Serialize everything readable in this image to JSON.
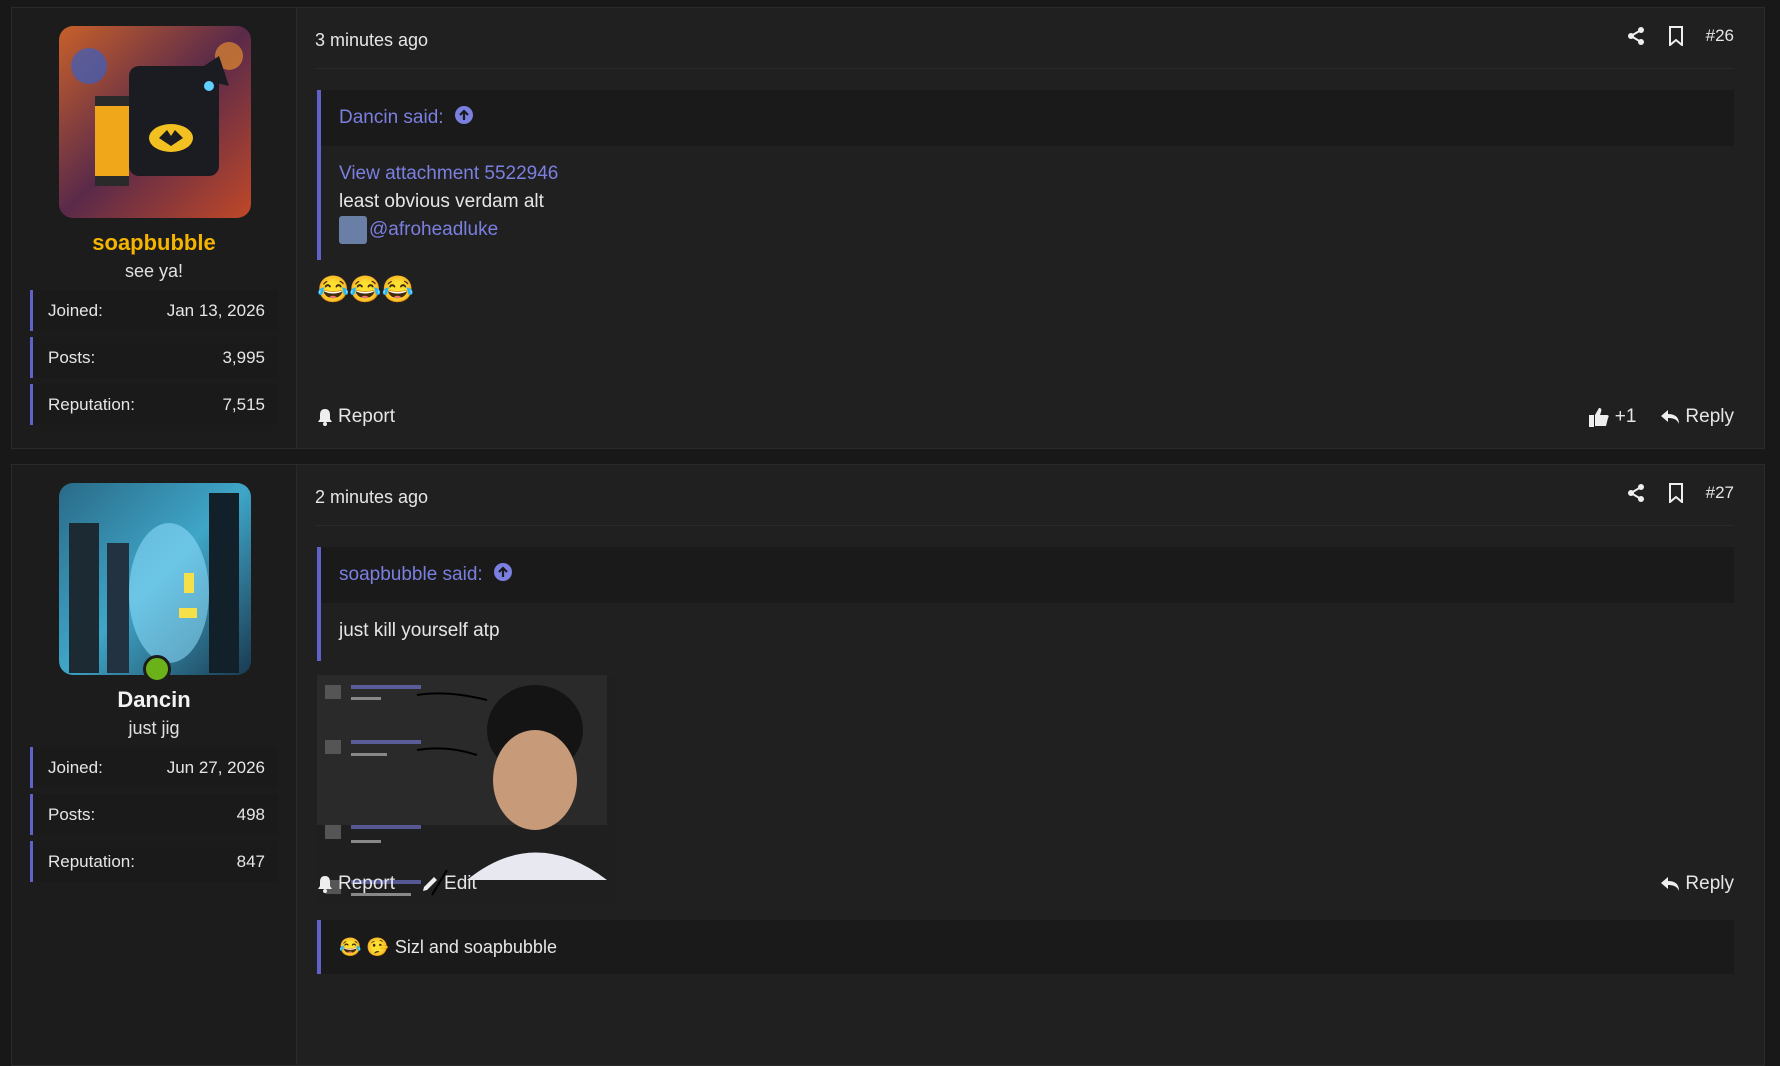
{
  "posts": [
    {
      "author": {
        "name": "soapbubble",
        "title": "see ya!",
        "stats": [
          {
            "label": "Joined:",
            "value": "Jan 13, 2026"
          },
          {
            "label": "Posts:",
            "value": "3,995"
          },
          {
            "label": "Reputation:",
            "value": "7,515"
          }
        ]
      },
      "time": "3 minutes ago",
      "number": "#26",
      "quote": {
        "header": "Dancin said:",
        "attachment_link": "View attachment 5522946",
        "text": "least obvious verdam alt",
        "mention": "@afroheadluke"
      },
      "body_emoji": "😂😂😂",
      "actions": {
        "report": "Report",
        "like_count": "+1",
        "reply": "Reply"
      }
    },
    {
      "author": {
        "name": "Dancin",
        "title": "just jig",
        "stats": [
          {
            "label": "Joined:",
            "value": "Jun 27, 2026"
          },
          {
            "label": "Posts:",
            "value": "498"
          },
          {
            "label": "Reputation:",
            "value": "847"
          }
        ]
      },
      "time": "2 minutes ago",
      "number": "#27",
      "quote": {
        "header": "soapbubble said:",
        "text": "just kill yourself atp"
      },
      "actions": {
        "report": "Report",
        "edit": "Edit",
        "reply": "Reply"
      },
      "reactions": {
        "emoji": "😂 🤥",
        "text": "Sizl and soapbubble"
      }
    }
  ],
  "colors": {
    "accent": "#5f63c9",
    "link": "#7b7fe0",
    "gold_username": "#f5b400",
    "online": "#6bb21a"
  }
}
